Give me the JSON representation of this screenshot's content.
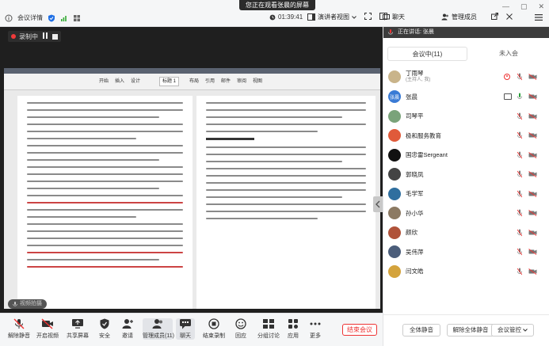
{
  "titlebar": {
    "meeting_details": "会议详情",
    "share_banner": "您正在观看张晨的屏幕",
    "timer": "01:39:41",
    "view_mode": "演讲者视图",
    "chat": "聊天",
    "manage_members": "管理成员"
  },
  "stage": {
    "recording": "录制中",
    "doc_status": "视频拍摄",
    "ribbon": {
      "tabs": [
        "开始",
        "插入",
        "设计",
        "布局",
        "引用",
        "邮件",
        "审阅",
        "视图"
      ],
      "style_box": "标题 1"
    }
  },
  "speaker_bar": {
    "label": "正在讲话:",
    "name": "张晨"
  },
  "toolbar": {
    "items": [
      {
        "label": "解除静音"
      },
      {
        "label": "开启视频"
      },
      {
        "label": "共享屏幕"
      },
      {
        "label": "安全"
      },
      {
        "label": "邀请"
      },
      {
        "label": "管理成员(11)"
      },
      {
        "label": "聊天"
      },
      {
        "label": "结束录制"
      },
      {
        "label": "回应"
      },
      {
        "label": "分组讨论"
      },
      {
        "label": "应用"
      },
      {
        "label": "更多"
      }
    ],
    "end_meeting": "结束会议"
  },
  "panel": {
    "tabs": {
      "in_meeting": "会议中(11)",
      "not_joined": "未入会"
    },
    "members": [
      {
        "name": "丁雨琴",
        "sub": "(主持人, 我)",
        "avatar_color": "#c9b48a",
        "avatar_text": ""
      },
      {
        "name": "张晨",
        "sub": "",
        "avatar_color": "#3a7bd5",
        "avatar_text": "张晨"
      },
      {
        "name": "司琴平",
        "sub": "",
        "avatar_color": "#7aa37a",
        "avatar_text": ""
      },
      {
        "name": "极和服务教育",
        "sub": "",
        "avatar_color": "#e05a3a",
        "avatar_text": ""
      },
      {
        "name": "国忠雷Sergeant",
        "sub": "",
        "avatar_color": "#111111",
        "avatar_text": ""
      },
      {
        "name": "郭晓凤",
        "sub": "",
        "avatar_color": "#444444",
        "avatar_text": ""
      },
      {
        "name": "毛学军",
        "sub": "",
        "avatar_color": "#2f6f9f",
        "avatar_text": ""
      },
      {
        "name": "孙小华",
        "sub": "",
        "avatar_color": "#8c7a63",
        "avatar_text": ""
      },
      {
        "name": "颜欣",
        "sub": "",
        "avatar_color": "#b0533a",
        "avatar_text": ""
      },
      {
        "name": "吴伟萍",
        "sub": "",
        "avatar_color": "#4b5d7a",
        "avatar_text": ""
      },
      {
        "name": "闫文皓",
        "sub": "",
        "avatar_color": "#d4a33c",
        "avatar_text": ""
      }
    ],
    "footer": {
      "mute_all": "全体静音",
      "unmute_all": "解除全体静音",
      "meeting_control": "会议管控"
    }
  },
  "colors": {
    "accent": "#1f6fe5",
    "danger": "#e53333",
    "stage_bg": "#1f1f1f"
  }
}
